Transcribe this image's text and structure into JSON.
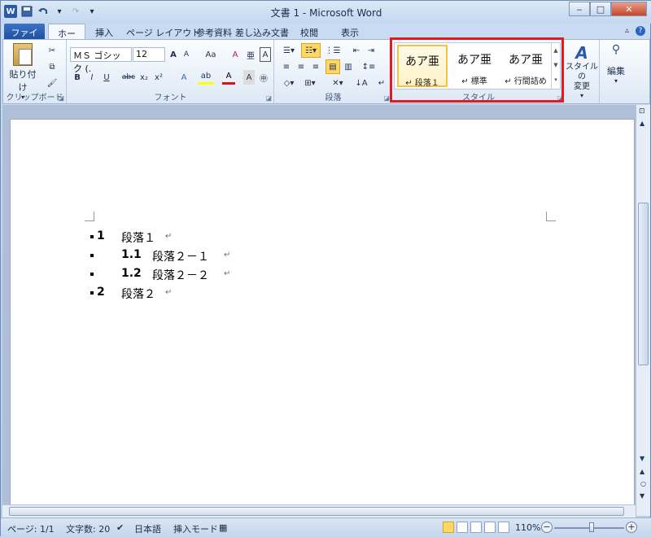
{
  "window": {
    "title": "文書 1 - Microsoft Word"
  },
  "qat": {
    "word_icon": "W",
    "save_icon": "save-icon",
    "undo_icon": "undo-icon"
  },
  "window_buttons": {
    "minimize": "‒",
    "maximize": "□",
    "close": "✕"
  },
  "tabs": [
    {
      "label": "ファイル"
    },
    {
      "label": "ホーム"
    },
    {
      "label": "挿入"
    },
    {
      "label": "ページ レイアウト"
    },
    {
      "label": "参考資料"
    },
    {
      "label": "差し込み文書"
    },
    {
      "label": "校閲"
    },
    {
      "label": "表示"
    }
  ],
  "ribbon": {
    "clipboard": {
      "label": "クリップボード",
      "paste": "貼り付け"
    },
    "font": {
      "label": "フォント",
      "font_name": "ＭＳ ゴシック (.",
      "font_size": "12",
      "bold": "B",
      "italic": "I",
      "underline": "U",
      "strike": "abc",
      "subscript": "x₂",
      "superscript": "x²",
      "grow": "A",
      "shrink": "A",
      "case": "Aa",
      "clear": "A",
      "font_color": "A",
      "highlight": "ab"
    },
    "paragraph": {
      "label": "段落"
    },
    "styles": {
      "label": "スタイル",
      "items": [
        {
          "preview": "あア亜",
          "name": "↵ 段落１"
        },
        {
          "preview": "あア亜",
          "name": "↵ 標準"
        },
        {
          "preview": "あア亜",
          "name": "↵ 行間詰め"
        }
      ],
      "change_styles": "スタイルの\n変更"
    },
    "editing": {
      "label": "編集"
    }
  },
  "document": {
    "lines": [
      {
        "num": "1",
        "text": "段落１",
        "mark": "↵"
      },
      {
        "num": "1.1",
        "text": "段落２－１",
        "mark": "↵"
      },
      {
        "num": "1.2",
        "text": "段落２－２",
        "mark": "↵"
      },
      {
        "num": "2",
        "text": "段落２",
        "mark": "↵"
      }
    ]
  },
  "status": {
    "page": "ページ: 1/1",
    "words": "文字数: 20",
    "language": "日本語",
    "mode": "挿入モード",
    "zoom": "110%",
    "zoom_fraction": 0.55
  },
  "colors": {
    "accent_red": "#e01b24",
    "file_tab": "#2a5aa8",
    "style_selected": "#f2c24a"
  }
}
